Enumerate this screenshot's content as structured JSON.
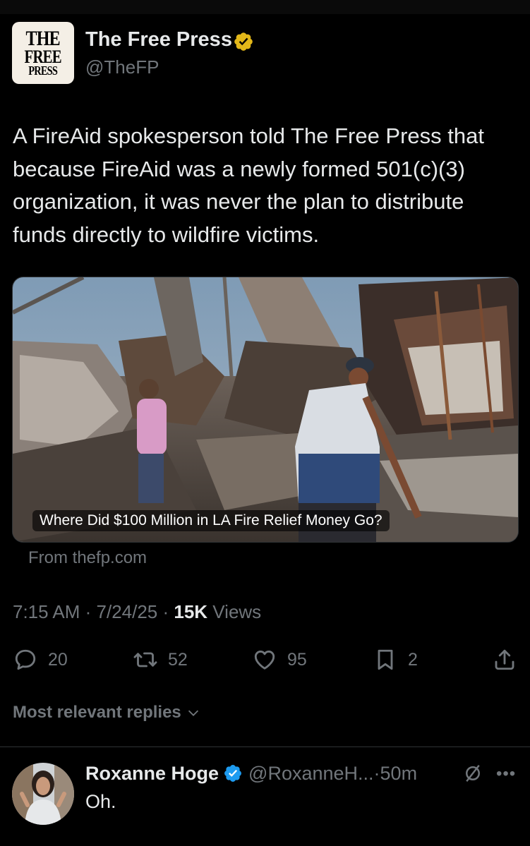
{
  "post": {
    "logo": {
      "line1": "THE",
      "line2": "FREE",
      "line3": "PRESS"
    },
    "author_name": "The Free Press",
    "author_handle": "@TheFP",
    "verified_color": "#e2b719",
    "text": "A FireAid spokesperson told The Free Press that because FireAid was a newly formed 501(c)(3) organization, it was never the plan to distribute funds directly to wildfire victims.",
    "card": {
      "title": "Where Did $100 Million in LA Fire Relief Money Go?",
      "source": "From thefp.com"
    },
    "meta": {
      "time": "7:15 AM",
      "sep1": " · ",
      "date": "7/24/25",
      "sep2": " · ",
      "views_count": "15K",
      "views_label": " Views"
    },
    "actions": {
      "reply_icon": "comment-icon",
      "replies": "20",
      "repost_icon": "repost-icon",
      "reposts": "52",
      "like_icon": "heart-icon",
      "likes": "95",
      "bookmark_icon": "bookmark-icon",
      "bookmarks": "2",
      "share_icon": "share-icon"
    }
  },
  "replies_section": {
    "sort_label": "Most relevant replies"
  },
  "reply": {
    "name": "Roxanne Hoge",
    "handle": "@RoxanneH...",
    "sep": " · ",
    "time": "50m",
    "text": "Oh.",
    "verified_color": "#1d9bf0"
  },
  "colors": {
    "background": "#000000",
    "text_primary": "#e7e9ea",
    "text_secondary": "#71767b",
    "divider": "#2f3336"
  }
}
